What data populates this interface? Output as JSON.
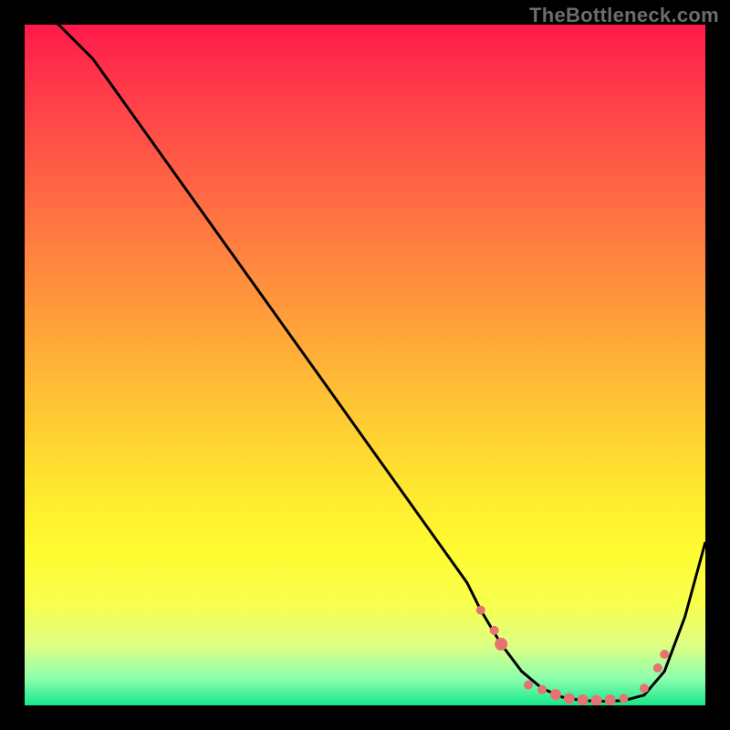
{
  "watermark": "TheBottleneck.com",
  "chart_data": {
    "type": "line",
    "title": "",
    "xlabel": "",
    "ylabel": "",
    "xlim": [
      0,
      100
    ],
    "ylim": [
      0,
      100
    ],
    "series": [
      {
        "name": "bottleneck-curve",
        "x": [
          0,
          5,
          10,
          15,
          20,
          25,
          30,
          35,
          40,
          45,
          50,
          55,
          60,
          65,
          67,
          70,
          73,
          76,
          79,
          82,
          85,
          88,
          91,
          94,
          97,
          100
        ],
        "y": [
          103,
          100,
          95,
          88,
          81,
          74,
          67,
          60,
          53,
          46,
          39,
          32,
          25,
          18,
          14,
          9,
          5,
          2.5,
          1.2,
          0.7,
          0.6,
          0.7,
          1.5,
          5,
          13,
          24
        ]
      }
    ],
    "markers": {
      "name": "highlight-segment",
      "color": "#e57373",
      "points": [
        {
          "x": 67,
          "y": 14,
          "r": 5
        },
        {
          "x": 69,
          "y": 11,
          "r": 5
        },
        {
          "x": 70,
          "y": 9,
          "r": 7
        },
        {
          "x": 74,
          "y": 3,
          "r": 5
        },
        {
          "x": 76,
          "y": 2.3,
          "r": 5
        },
        {
          "x": 78,
          "y": 1.6,
          "r": 6
        },
        {
          "x": 80,
          "y": 1.0,
          "r": 6
        },
        {
          "x": 82,
          "y": 0.8,
          "r": 6
        },
        {
          "x": 84,
          "y": 0.7,
          "r": 6
        },
        {
          "x": 86,
          "y": 0.8,
          "r": 6
        },
        {
          "x": 88,
          "y": 1.0,
          "r": 5
        },
        {
          "x": 91,
          "y": 2.5,
          "r": 5
        },
        {
          "x": 93,
          "y": 5.5,
          "r": 5
        },
        {
          "x": 94,
          "y": 7.5,
          "r": 5
        }
      ]
    },
    "background_gradient": {
      "top": "#ff1a4a",
      "mid": "#fff02e",
      "bottom": "#17e88b"
    }
  }
}
